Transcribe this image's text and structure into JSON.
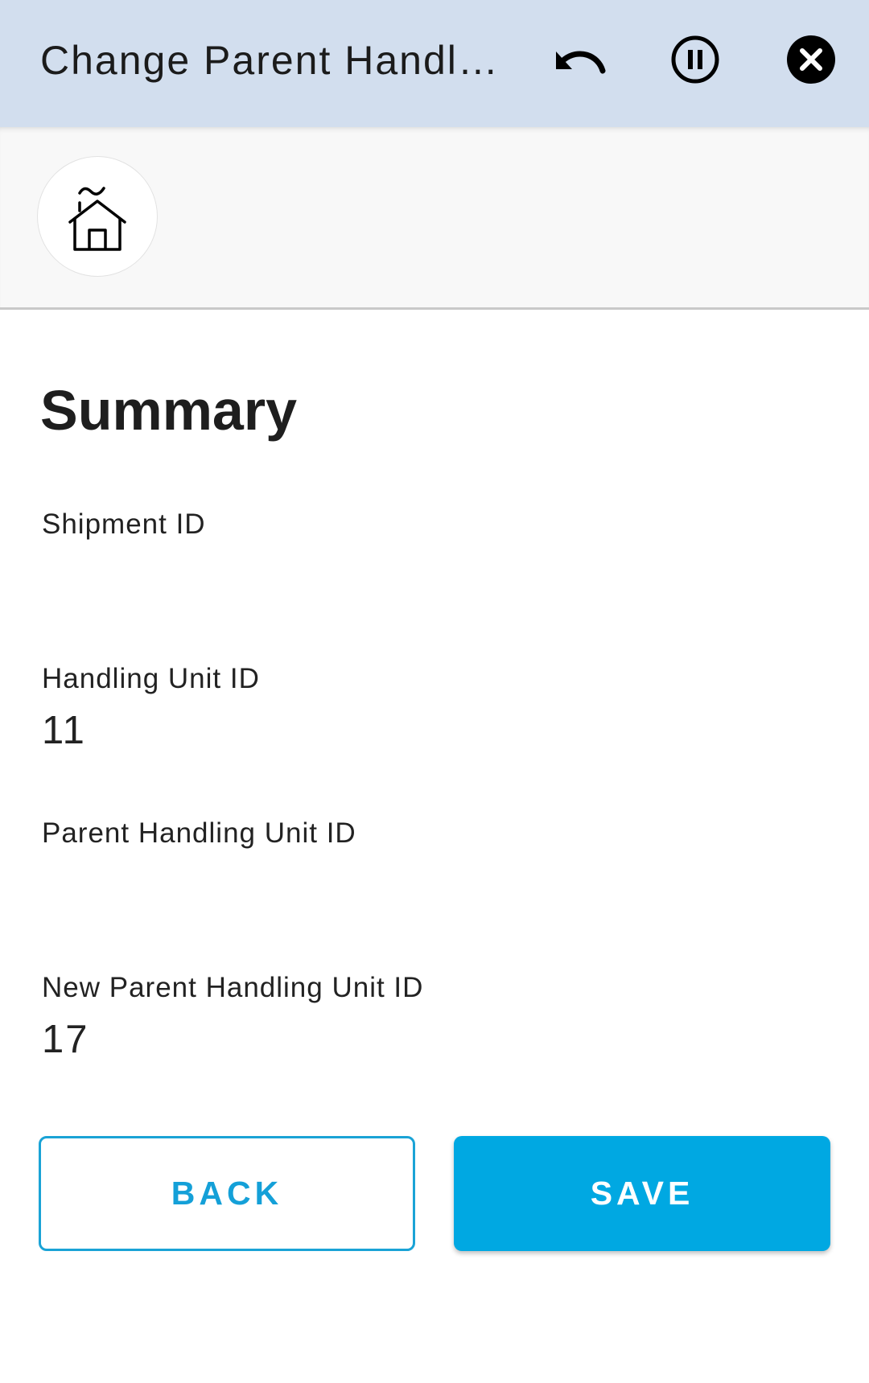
{
  "topbar": {
    "title": "Change Parent Handling Unit",
    "undo_icon": "undo-icon",
    "pause_icon": "pause-circle-icon",
    "close_icon": "close-circle-icon"
  },
  "subbar": {
    "home_icon": "home-icon"
  },
  "summary": {
    "title": "Summary",
    "fields": [
      {
        "label": "Shipment ID",
        "value": ""
      },
      {
        "label": "Handling Unit ID",
        "value": "11"
      },
      {
        "label": "Parent Handling Unit ID",
        "value": ""
      },
      {
        "label": "New Parent Handling Unit ID",
        "value": "17"
      }
    ]
  },
  "actions": {
    "back_label": "BACK",
    "save_label": "SAVE"
  },
  "colors": {
    "topbar_bg": "#d2deee",
    "accent": "#00a8e2"
  }
}
